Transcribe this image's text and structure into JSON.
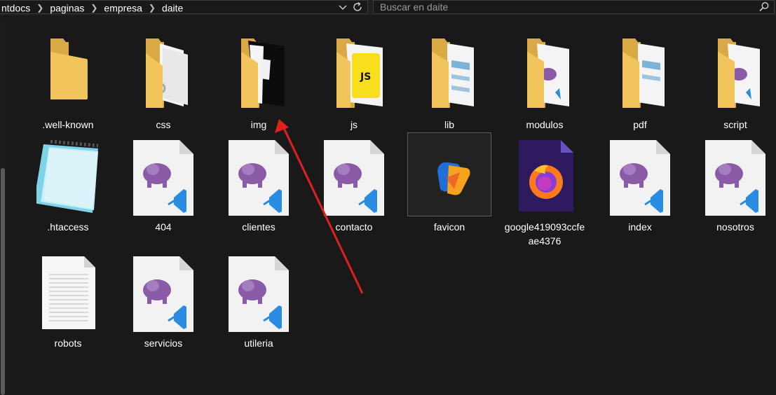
{
  "breadcrumb": {
    "segments": [
      "ntdocs",
      "paginas",
      "empresa",
      "daite"
    ]
  },
  "search": {
    "placeholder": "Buscar en daite"
  },
  "items": [
    {
      "label": ".well-known",
      "icon": "folder-icon"
    },
    {
      "label": "css",
      "icon": "folder-with-files-icon"
    },
    {
      "label": "img",
      "icon": "folder-with-images-icon"
    },
    {
      "label": "js",
      "icon": "folder-with-js-icon"
    },
    {
      "label": "lib",
      "icon": "folder-with-files-icon"
    },
    {
      "label": "modulos",
      "icon": "folder-with-php-icon"
    },
    {
      "label": "pdf",
      "icon": "folder-with-files-icon"
    },
    {
      "label": "script",
      "icon": "folder-with-php-icon"
    },
    {
      "label": ".htaccess",
      "icon": "notepad-icon"
    },
    {
      "label": "404",
      "icon": "php-file-icon"
    },
    {
      "label": "clientes",
      "icon": "php-file-icon"
    },
    {
      "label": "contacto",
      "icon": "php-file-icon"
    },
    {
      "label": "favicon",
      "icon": "favicon-image-icon"
    },
    {
      "label": "google419093ccfeae4376",
      "icon": "firefox-html-icon"
    },
    {
      "label": "index",
      "icon": "php-file-icon"
    },
    {
      "label": "nosotros",
      "icon": "php-file-icon"
    },
    {
      "label": "robots",
      "icon": "text-file-icon"
    },
    {
      "label": "servicios",
      "icon": "php-file-icon"
    },
    {
      "label": "utileria",
      "icon": "php-file-icon"
    }
  ],
  "colors": {
    "background": "#191919",
    "folder": "#f2c55c",
    "php_elephant": "#8a5ca8",
    "vscode_blue": "#2a8ce0",
    "annotation_arrow": "#e0201d"
  }
}
